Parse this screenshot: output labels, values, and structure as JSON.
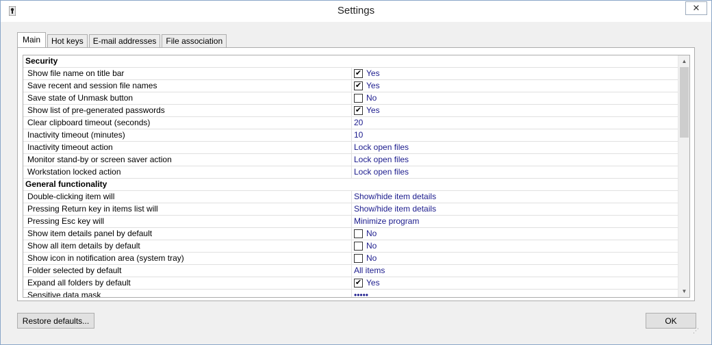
{
  "window": {
    "title": "Settings",
    "close_glyph": "✕",
    "app_icon": "keyhole-icon"
  },
  "tabs": [
    {
      "label": "Main",
      "active": true
    },
    {
      "label": "Hot keys",
      "active": false
    },
    {
      "label": "E-mail addresses",
      "active": false
    },
    {
      "label": "File association",
      "active": false
    }
  ],
  "settings": [
    {
      "type": "section",
      "label": "Security"
    },
    {
      "type": "check",
      "label": "Show file name on title bar",
      "checked": true,
      "value": "Yes"
    },
    {
      "type": "check",
      "label": "Save recent and session file names",
      "checked": true,
      "value": "Yes"
    },
    {
      "type": "check",
      "label": "Save state of Unmask button",
      "checked": false,
      "value": "No"
    },
    {
      "type": "check",
      "label": "Show list of pre-generated passwords",
      "checked": true,
      "value": "Yes"
    },
    {
      "type": "text",
      "label": "Clear clipboard timeout (seconds)",
      "value": "20"
    },
    {
      "type": "text",
      "label": "Inactivity timeout (minutes)",
      "value": "10"
    },
    {
      "type": "text",
      "label": "Inactivity timeout action",
      "value": "Lock open files"
    },
    {
      "type": "text",
      "label": "Monitor stand-by or screen saver action",
      "value": "Lock open files"
    },
    {
      "type": "text",
      "label": "Workstation locked action",
      "value": "Lock open files"
    },
    {
      "type": "section",
      "label": "General functionality"
    },
    {
      "type": "text",
      "label": "Double-clicking item will",
      "value": "Show/hide item details"
    },
    {
      "type": "text",
      "label": "Pressing Return key in items list will",
      "value": "Show/hide item details"
    },
    {
      "type": "text",
      "label": "Pressing Esc key will",
      "value": "Minimize program"
    },
    {
      "type": "check",
      "label": "Show item details panel by default",
      "checked": false,
      "value": "No"
    },
    {
      "type": "check",
      "label": "Show all item details by default",
      "checked": false,
      "value": "No"
    },
    {
      "type": "check",
      "label": "Show icon in notification area (system tray)",
      "checked": false,
      "value": "No"
    },
    {
      "type": "text",
      "label": "Folder selected by default",
      "value": "All items"
    },
    {
      "type": "check",
      "label": "Expand all folders by default",
      "checked": true,
      "value": "Yes"
    },
    {
      "type": "text",
      "label": "Sensitive data mask",
      "value": "•••••"
    }
  ],
  "buttons": {
    "restore_label": "Restore defaults...",
    "ok_label": "OK"
  },
  "scrollbar": {
    "up_glyph": "▲",
    "down_glyph": "▼"
  },
  "colors": {
    "value_text": "#1a1a8c",
    "title_bar": "#ffffff"
  }
}
